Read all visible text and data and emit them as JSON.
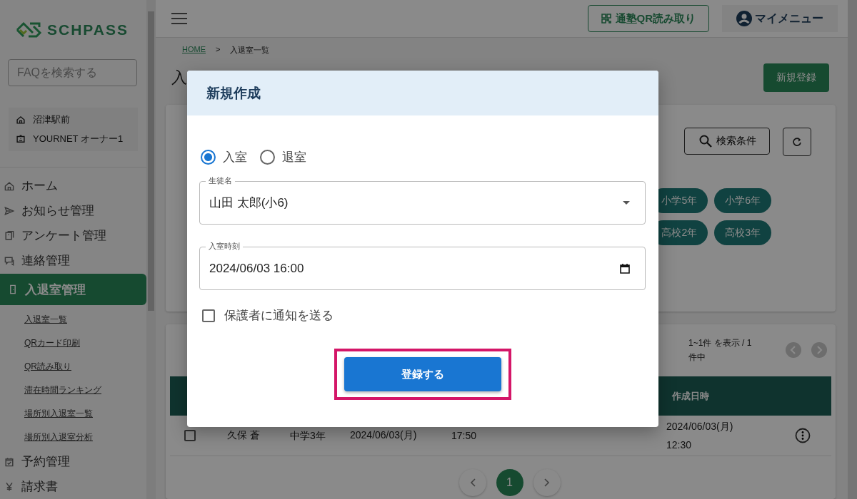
{
  "sidebar": {
    "logo": "SCHPASS",
    "faq_search": {
      "placeholder": "FAQを検索する"
    },
    "school": "沼津駅前",
    "user": "YOURNET オーナー1",
    "items": [
      {
        "label": "ホーム",
        "selected": false
      },
      {
        "label": "お知らせ管理",
        "selected": false
      },
      {
        "label": "アンケート管理",
        "selected": false
      },
      {
        "label": "連絡管理",
        "selected": false
      },
      {
        "label": "入退室管理",
        "selected": true,
        "children": [
          {
            "label": "入退室一覧"
          },
          {
            "label": "QRカード印刷"
          },
          {
            "label": "QR読み取り"
          },
          {
            "label": "滞在時間ランキング"
          },
          {
            "label": "場所別入退室一覧"
          },
          {
            "label": "場所別入退室分析"
          }
        ]
      },
      {
        "label": "予約管理",
        "selected": false
      },
      {
        "label": "請求書",
        "selected": false
      }
    ]
  },
  "header": {
    "qr_button": "通塾QR読み取り",
    "my_menu": "マイメニュー"
  },
  "breadcrumb": {
    "items": [
      "HOME",
      "入退室一覧"
    ],
    "separator": ">"
  },
  "page": {
    "title": "入",
    "new_button": "新規登録",
    "search_button": "検索条件",
    "grade_chips": [
      "小学5年",
      "小学6年",
      "高校2年",
      "高校3年"
    ]
  },
  "table": {
    "count_text": "1~1件 を表示 / 1件中",
    "columns": [
      "作成日時"
    ],
    "rows": [
      {
        "checked": false,
        "name": "久保 蒼",
        "grade": "中学3年",
        "date": "2024/06/03(月)",
        "time": "17:50",
        "created": "2024/06/03(月) 12:30"
      }
    ]
  },
  "pagination": {
    "pages": [
      {
        "label": "1",
        "selected": true
      }
    ]
  },
  "dialog": {
    "title": "新規作成",
    "options": [
      {
        "label": "入室",
        "selected": true
      },
      {
        "label": "退室",
        "selected": false
      }
    ],
    "student": {
      "label": "生徒名",
      "value": "山田 太郎(小6)"
    },
    "time": {
      "label": "入室時刻",
      "value": "2024/06/03 16:00"
    },
    "notify": {
      "label": "保護者に通知を送る",
      "checked": false
    },
    "submit": "登録する",
    "submit_highlighted": true
  }
}
